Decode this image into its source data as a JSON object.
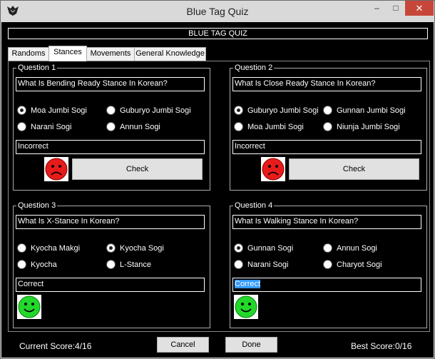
{
  "window": {
    "title": "Blue Tag Quiz",
    "minimize_glyph": "–",
    "maximize_glyph": "□",
    "close_glyph": "✕"
  },
  "header": {
    "text": "BLUE TAG QUIZ"
  },
  "tabs": [
    {
      "label": "Randoms",
      "active": false
    },
    {
      "label": "Stances",
      "active": true
    },
    {
      "label": "Movements",
      "active": false
    },
    {
      "label": "General Knowledge",
      "active": false
    }
  ],
  "questions": [
    {
      "group_label": "Question 1",
      "question": "What Is Bending Ready Stance In Korean?",
      "options": [
        {
          "label": "Moa Jumbi Sogi",
          "selected": true
        },
        {
          "label": "Guburyo Jumbi Sogi",
          "selected": false
        },
        {
          "label": "Narani Sogi",
          "selected": false
        },
        {
          "label": "Annun Sogi",
          "selected": false
        }
      ],
      "result": "Incorrect",
      "face": "sad-face-icon",
      "check_label": "Check"
    },
    {
      "group_label": "Question 2",
      "question": "What Is Close Ready Stance In Korean?",
      "options": [
        {
          "label": "Guburyo Jumbi Sogi",
          "selected": true
        },
        {
          "label": "Gunnan Jumbi Sogi",
          "selected": false
        },
        {
          "label": "Moa Jumbi Sogi",
          "selected": false
        },
        {
          "label": "Niunja Jumbi Sogi",
          "selected": false
        }
      ],
      "result": "Incorrect",
      "face": "sad-face-icon",
      "check_label": "Check"
    },
    {
      "group_label": "Question 3",
      "question": "What Is X-Stance In Korean?",
      "options": [
        {
          "label": "Kyocha Makgi",
          "selected": false
        },
        {
          "label": "Kyocha Sogi",
          "selected": true
        },
        {
          "label": "Kyocha",
          "selected": false
        },
        {
          "label": "L-Stance",
          "selected": false
        }
      ],
      "result": "Correct",
      "face": "happy-face-icon"
    },
    {
      "group_label": "Question 4",
      "question": "What Is Walking Stance In Korean?",
      "options": [
        {
          "label": "Gunnan Sogi",
          "selected": true
        },
        {
          "label": "Annun Sogi",
          "selected": false
        },
        {
          "label": "Narani Sogi",
          "selected": false
        },
        {
          "label": "Charyot Sogi",
          "selected": false
        }
      ],
      "result": "Correct",
      "face": "happy-face-icon"
    }
  ],
  "footer": {
    "current_score": "Current Score:4/16",
    "best_score": "Best Score:0/16",
    "cancel_label": "Cancel",
    "done_label": "Done"
  },
  "colors": {
    "background": "#000000",
    "sad_face": "#e81b1b",
    "happy_face": "#22d82a",
    "selection": "#3399ff",
    "close_button": "#c7463a"
  }
}
